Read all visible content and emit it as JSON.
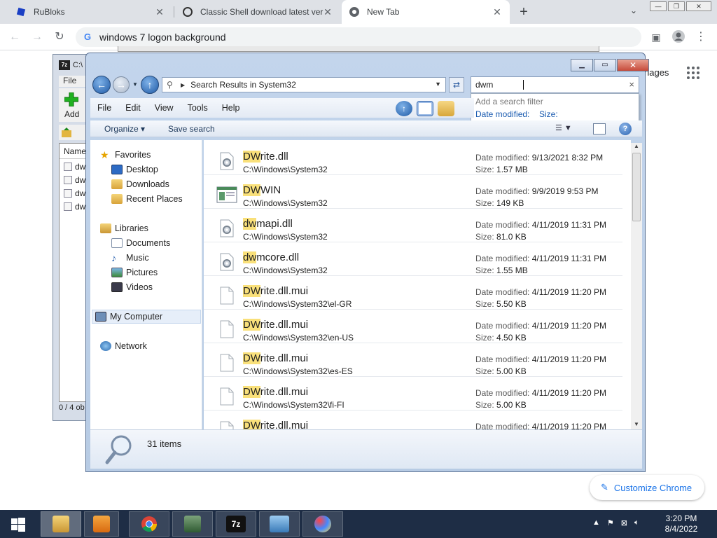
{
  "chrome": {
    "tabs": [
      {
        "title": "RuBloks",
        "icon": "rubloks-icon"
      },
      {
        "title": "Classic Shell download latest ver",
        "icon": "classic-shell-icon"
      },
      {
        "title": "New Tab",
        "icon": "chrome-icon"
      }
    ],
    "address": "windows 7 logon background",
    "page": {
      "images_link": "nages",
      "customize_label": "Customize Chrome"
    }
  },
  "sevenzip": {
    "title": "C:\\",
    "menu_file": "File",
    "add_label": "Add",
    "list_header": "Name",
    "rows": [
      "dw",
      "dw",
      "dw",
      "dw"
    ],
    "status": "0 / 4 ob"
  },
  "explorer": {
    "address": "Search Results in System32",
    "search_value": "dwm",
    "filter": {
      "hint": "Add a search filter",
      "date_modified": "Date modified:",
      "size": "Size:"
    },
    "menu": [
      "File",
      "Edit",
      "View",
      "Tools",
      "Help"
    ],
    "commands": {
      "organize": "Organize ▾",
      "save_search": "Save search"
    },
    "nav": {
      "favorites": "Favorites",
      "desktop": "Desktop",
      "downloads": "Downloads",
      "recent": "Recent Places",
      "libraries": "Libraries",
      "documents": "Documents",
      "music": "Music",
      "pictures": "Pictures",
      "videos": "Videos",
      "computer": "My Computer",
      "network": "Network"
    },
    "date_label": "Date modified:",
    "size_label": "Size:",
    "results": [
      {
        "hl": "DW",
        "rest": "rite.dll",
        "path": "C:\\Windows\\System32",
        "date": "9/13/2021 8:32 PM",
        "size": "1.57 MB",
        "icon": "dll-gear-icon"
      },
      {
        "hl": "DW",
        "rest": "WIN",
        "path": "C:\\Windows\\System32",
        "date": "9/9/2019 9:53 PM",
        "size": "149 KB",
        "icon": "exe-window-icon"
      },
      {
        "hl": "dw",
        "rest": "mapi.dll",
        "path": "C:\\Windows\\System32",
        "date": "4/11/2019 11:31 PM",
        "size": "81.0 KB",
        "icon": "dll-gear-icon"
      },
      {
        "hl": "dw",
        "rest": "mcore.dll",
        "path": "C:\\Windows\\System32",
        "date": "4/11/2019 11:31 PM",
        "size": "1.55 MB",
        "icon": "dll-gear-icon"
      },
      {
        "hl": "DW",
        "rest": "rite.dll.mui",
        "path": "C:\\Windows\\System32\\el-GR",
        "date": "4/11/2019 11:20 PM",
        "size": "5.50 KB",
        "icon": "blank-file-icon"
      },
      {
        "hl": "DW",
        "rest": "rite.dll.mui",
        "path": "C:\\Windows\\System32\\en-US",
        "date": "4/11/2019 11:20 PM",
        "size": "4.50 KB",
        "icon": "blank-file-icon"
      },
      {
        "hl": "DW",
        "rest": "rite.dll.mui",
        "path": "C:\\Windows\\System32\\es-ES",
        "date": "4/11/2019 11:20 PM",
        "size": "5.00 KB",
        "icon": "blank-file-icon"
      },
      {
        "hl": "DW",
        "rest": "rite.dll.mui",
        "path": "C:\\Windows\\System32\\fi-FI",
        "date": "4/11/2019 11:20 PM",
        "size": "5.00 KB",
        "icon": "blank-file-icon"
      },
      {
        "hl": "DW",
        "rest": "rite.dll.mui",
        "path": "",
        "date": "4/11/2019 11:20 PM",
        "size": "",
        "icon": "blank-file-icon"
      }
    ],
    "item_count": "31 items"
  },
  "taskbar": {
    "clock_time": "3:20 PM",
    "clock_date": "8/4/2022",
    "apps": [
      "explorer-icon",
      "media-player-icon",
      "chrome-icon",
      "remote-desktop-icon",
      "7zip-icon",
      "photo-viewer-icon",
      "paint-icon"
    ]
  },
  "colors": {
    "highlight": "#f9e07a",
    "link_blue": "#1a73e8",
    "taskbar": "#1e2d45"
  }
}
